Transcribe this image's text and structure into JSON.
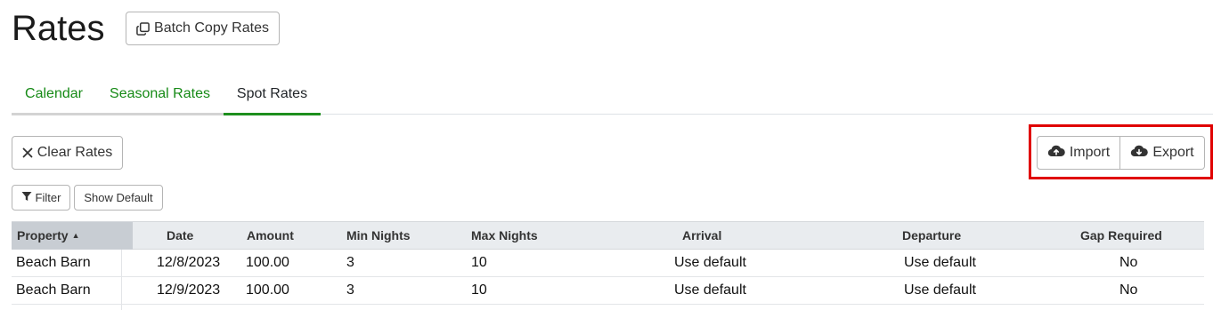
{
  "page": {
    "title": "Rates",
    "batch_copy_label": "Batch Copy Rates"
  },
  "tabs": [
    {
      "label": "Calendar",
      "active": false
    },
    {
      "label": "Seasonal Rates",
      "active": false
    },
    {
      "label": "Spot Rates",
      "active": true
    }
  ],
  "toolbar": {
    "clear_label": "Clear Rates",
    "import_label": "Import",
    "export_label": "Export",
    "filter_label": "Filter",
    "show_default_label": "Show Default"
  },
  "icons": {
    "batch_copy": "copy-icon",
    "clear": "x-icon",
    "import": "cloud-upload-icon",
    "export": "cloud-download-icon",
    "filter": "funnel-icon",
    "sort": "sort-ascending-icon"
  },
  "colors": {
    "tab_link": "#168a16",
    "tab_active_underline": "#1d8f1d",
    "highlight_box": "#e00000"
  },
  "table": {
    "columns": [
      "Property",
      "Date",
      "Amount",
      "Min Nights",
      "Max Nights",
      "Arrival",
      "Departure",
      "Gap Required"
    ],
    "sorted_column": "Property",
    "rows": [
      [
        "Beach Barn",
        "12/8/2023",
        "100.00",
        "3",
        "10",
        "Use default",
        "Use default",
        "No"
      ],
      [
        "Beach Barn",
        "12/9/2023",
        "100.00",
        "3",
        "10",
        "Use default",
        "Use default",
        "No"
      ]
    ]
  }
}
